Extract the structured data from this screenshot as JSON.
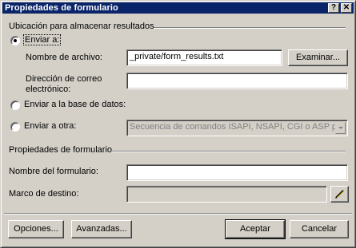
{
  "window": {
    "title": "Propiedades de formulario",
    "help_button": "?",
    "close_button": "✕"
  },
  "storage_group": {
    "title": "Ubicación para almacenar resultados",
    "send_to": {
      "label": "Enviar a:",
      "selected": true,
      "file_name_label": "Nombre de archivo:",
      "file_name_value": "_private/form_results.txt",
      "browse_button": "Examinar...",
      "email_label_line1": "Dirección de correo",
      "email_label_line2": "electrónico:",
      "email_value": ""
    },
    "send_to_database": {
      "label": "Enviar a la base de datos:",
      "selected": false
    },
    "send_to_other": {
      "label": "Enviar a otra:",
      "selected": false,
      "select_value": "Secuencia de comandos ISAPI, NSAPI, CGI o ASP pe"
    }
  },
  "form_properties_group": {
    "title": "Propiedades de formulario",
    "form_name_label": "Nombre del formulario:",
    "form_name_value": "",
    "target_frame_label": "Marco de destino:",
    "target_frame_value": ""
  },
  "buttons": {
    "options": "Opciones...",
    "advanced": "Avanzadas...",
    "ok": "Aceptar",
    "cancel": "Cancelar"
  }
}
